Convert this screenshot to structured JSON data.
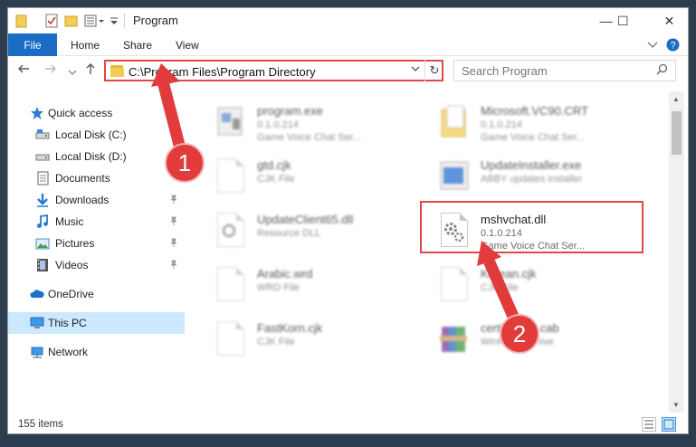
{
  "window": {
    "title": "Program",
    "controls": {
      "minimize": "—",
      "maximize": "☐",
      "close": "✕"
    }
  },
  "ribbon": {
    "tabs": [
      "File",
      "Home",
      "Share",
      "View"
    ],
    "expand_icon": "chevron-down-icon",
    "help_icon": "help-icon"
  },
  "address_bar": {
    "path": "C:\\Program Files\\Program Directory",
    "refresh_glyph": "↻",
    "dropdown_glyph": "⌄"
  },
  "search": {
    "placeholder": "Search Program",
    "icon_glyph": "⌕"
  },
  "sidebar": {
    "items": [
      {
        "label": "Quick access",
        "icon": "star-icon",
        "pinned": false
      },
      {
        "label": "Local Disk (C:)",
        "icon": "drive-icon",
        "pinned": false
      },
      {
        "label": "Local Disk (D:)",
        "icon": "drive-icon",
        "pinned": false
      },
      {
        "label": "Documents",
        "icon": "documents-icon",
        "pinned": false
      },
      {
        "label": "Downloads",
        "icon": "download-icon",
        "pinned": true
      },
      {
        "label": "Music",
        "icon": "music-icon",
        "pinned": true
      },
      {
        "label": "Pictures",
        "icon": "pictures-icon",
        "pinned": true
      },
      {
        "label": "Videos",
        "icon": "video-icon",
        "pinned": true
      },
      {
        "label": "OneDrive",
        "icon": "cloud-icon",
        "pinned": false
      },
      {
        "label": "This PC",
        "icon": "computer-icon",
        "pinned": false,
        "selected": true
      },
      {
        "label": "Network",
        "icon": "network-icon",
        "pinned": false
      }
    ],
    "pin_glyph": "📌"
  },
  "files": [
    {
      "name": "program.exe",
      "line1": "0.1.0.214",
      "line2": "Game Voice Chat Ser...",
      "icon": "exe-icon",
      "blurred": true
    },
    {
      "name": "Microsoft.VC90.CRT",
      "line1": "0.1.0.214",
      "line2": "Game Voice Chat Ser...",
      "icon": "folder-icon",
      "blurred": true
    },
    {
      "name": "gtd.cjk",
      "line1": "CJK File",
      "line2": "",
      "icon": "file-icon",
      "blurred": true
    },
    {
      "name": "UpdateInstaller.exe",
      "line1": "ABBY updates installer",
      "line2": "",
      "icon": "installer-icon",
      "blurred": true
    },
    {
      "name": "UpdateClient65.dll",
      "line1": "Resource DLL",
      "line2": "",
      "icon": "dll-icon",
      "blurred": true
    },
    {
      "name": "mshvchat.dll",
      "line1": "0.1.0.214",
      "line2": "Game Voice Chat Ser...",
      "icon": "dll-gear-icon",
      "blurred": false,
      "highlighted": true
    },
    {
      "name": "Arabic.wrd",
      "line1": "WRD File",
      "line2": "",
      "icon": "file-icon",
      "blurred": true
    },
    {
      "name": "Korean.cjk",
      "line1": "CJK File",
      "line2": "",
      "icon": "file-icon",
      "blurred": true
    },
    {
      "name": "FastKorn.cjk",
      "line1": "CJK File",
      "line2": "",
      "icon": "file-icon",
      "blurred": true
    },
    {
      "name": "certificates.cab",
      "line1": "WinRAR archive",
      "line2": "",
      "icon": "archive-icon",
      "blurred": true
    }
  ],
  "status": {
    "item_count": "155 items"
  },
  "annotations": [
    {
      "number": "1",
      "color": "#e23b3b"
    },
    {
      "number": "2",
      "color": "#e23b3b"
    }
  ]
}
